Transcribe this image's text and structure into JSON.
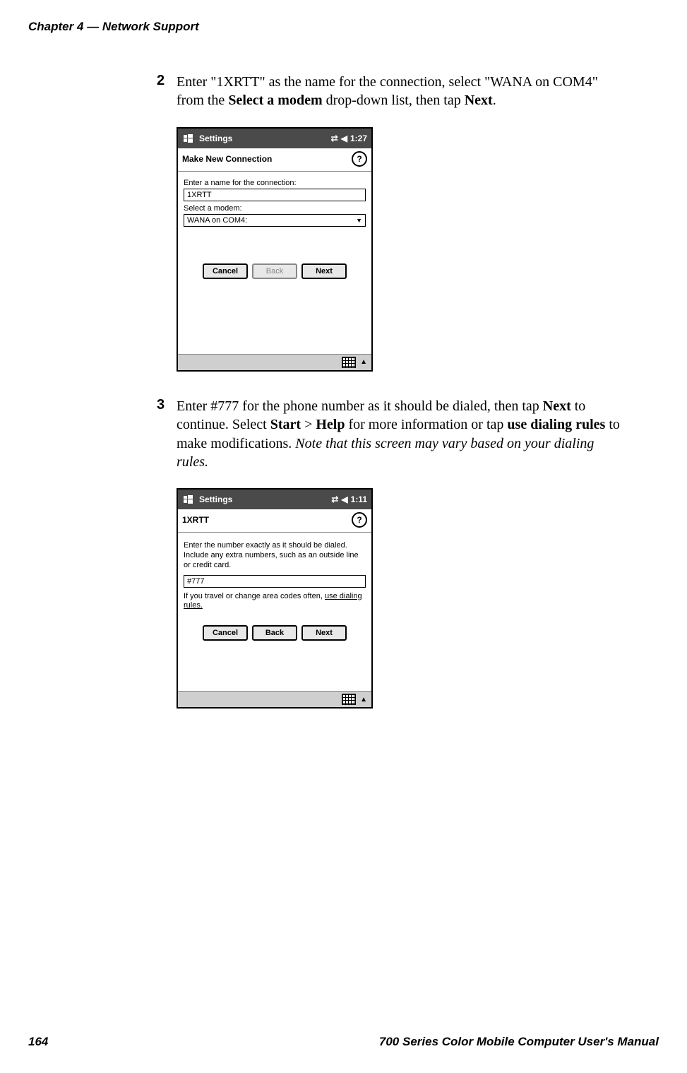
{
  "header": {
    "chapter": "Chapter 4",
    "dash": "—",
    "section": "Network Support"
  },
  "steps": {
    "s2": {
      "num": "2",
      "t1": "Enter \"1XRTT\" as the name for the connection, select \"WANA on COM4\" from the ",
      "b1": "Select a modem",
      "t2": " drop-down list, then tap ",
      "b2": "Next",
      "t3": "."
    },
    "s3": {
      "num": "3",
      "t1": "Enter #777 for the phone number as it should be dialed, then tap ",
      "b1": "Next",
      "t2": " to continue. Select ",
      "b2": "Start",
      "t3": " > ",
      "b3": "Help",
      "t4": " for more information or tap ",
      "b4": "use dialing rules",
      "t5": " to make modifications. ",
      "i1": "Note that this screen may vary based on your dialing rules."
    }
  },
  "ss1": {
    "title": "Settings",
    "clock": "1:27",
    "subtitle": "Make New Connection",
    "label_name": "Enter a name for the connection:",
    "input_name": "1XRTT",
    "label_modem": "Select a modem:",
    "select_value": "WANA on COM4:",
    "btn_cancel": "Cancel",
    "btn_back": "Back",
    "btn_next": "Next"
  },
  "ss2": {
    "title": "Settings",
    "clock": "1:11",
    "subtitle": "1XRTT",
    "para1": "Enter the number exactly as it should be dialed.  Include any extra numbers, such as an outside line or credit card.",
    "input_num": "#777",
    "para2a": "If you travel or change area codes often, ",
    "link": "use dialing rules.",
    "btn_cancel": "Cancel",
    "btn_back": "Back",
    "btn_next": "Next"
  },
  "footer": {
    "page": "164",
    "title": "700 Series Color Mobile Computer User's Manual"
  },
  "icons": {
    "help": "?",
    "signal": "⇄",
    "sound": "◀",
    "dd": "▼",
    "up": "▲"
  }
}
